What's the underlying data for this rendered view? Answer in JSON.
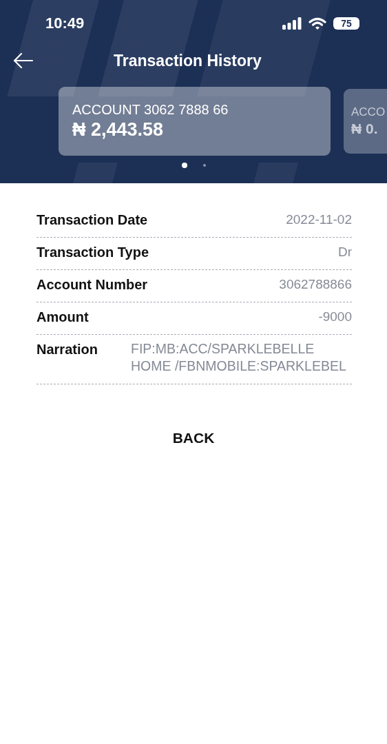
{
  "status_bar": {
    "time": "10:49",
    "battery": "75"
  },
  "header": {
    "title": "Transaction History"
  },
  "accounts": [
    {
      "label": "ACCOUNT 3062 7888 66",
      "balance": "₦ 2,443.58",
      "selected": true
    },
    {
      "label": "ACCO",
      "balance": "₦ 0.",
      "selected": false
    }
  ],
  "pager": [
    {
      "selected": true
    },
    {
      "selected": false
    }
  ],
  "details": [
    {
      "label": "Transaction Date",
      "value": "2022-11-02"
    },
    {
      "label": "Transaction Type",
      "value": "Dr"
    },
    {
      "label": "Account Number",
      "value": "3062788866"
    },
    {
      "label": "Amount",
      "value": "-9000"
    },
    {
      "label": "Narration",
      "value": "FIP:MB:ACC/SPARKLEBELLE HOME /FBNMOBILE:SPARKLEBEL",
      "kind": "long"
    }
  ],
  "back_button": "BACK"
}
